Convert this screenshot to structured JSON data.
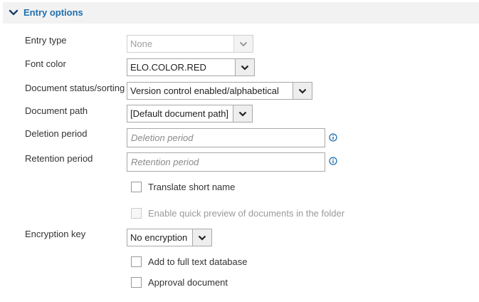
{
  "section": {
    "title": "Entry options"
  },
  "fields": {
    "entry_type": {
      "label": "Entry type",
      "value": "None"
    },
    "font_color": {
      "label": "Font color",
      "value": "ELO.COLOR.RED"
    },
    "document_status": {
      "label": "Document status/sorting",
      "value": "Version control enabled/alphabetical"
    },
    "document_path": {
      "label": "Document path",
      "value": "[Default document path]"
    },
    "deletion_period": {
      "label": "Deletion period",
      "placeholder": "Deletion period"
    },
    "retention_period": {
      "label": "Retention period",
      "placeholder": "Retention period"
    },
    "encryption_key": {
      "label": "Encryption key",
      "value": "No encryption"
    }
  },
  "checkboxes": {
    "translate_short_name": {
      "label": "Translate short name",
      "checked": false
    },
    "quick_preview": {
      "label": "Enable quick preview of documents in the folder",
      "checked": false,
      "disabled": true
    },
    "full_text": {
      "label": "Add to full text database",
      "checked": false
    },
    "approval": {
      "label": "Approval document",
      "checked": false
    }
  },
  "colors": {
    "accent": "#1f6fae",
    "header_bg": "#f2f2f2",
    "info_icon": "#1f6fae"
  },
  "icons": {
    "section_toggle": "chevron-down-icon",
    "dropdown": "chevron-down-icon",
    "info": "info-icon"
  }
}
